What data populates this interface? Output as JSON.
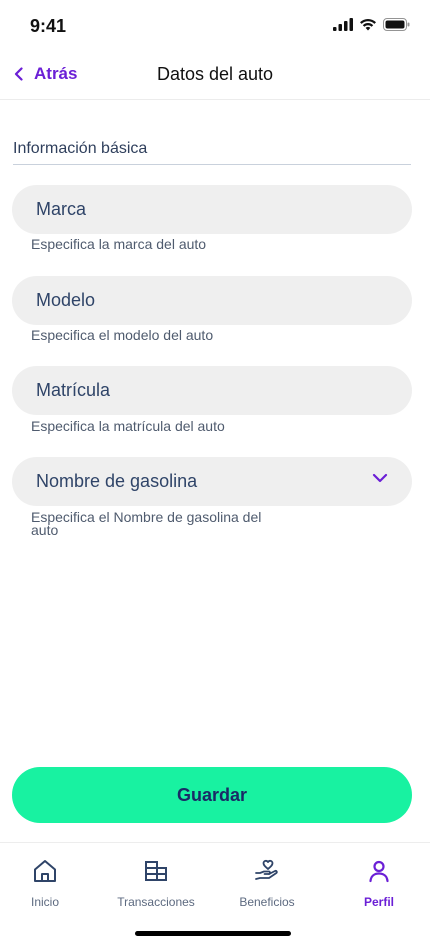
{
  "status_bar": {
    "time": "9:41"
  },
  "header": {
    "back_label": "Atrás",
    "title": "Datos del auto"
  },
  "form": {
    "section_title": "Información básica",
    "fields": [
      {
        "placeholder": "Marca",
        "hint": "Especifica la marca del auto"
      },
      {
        "placeholder": "Modelo",
        "hint": "Especifica el modelo del auto"
      },
      {
        "placeholder": "Matrícula",
        "hint": "Especifica la matrícula del auto"
      },
      {
        "placeholder": "Nombre de gasolina",
        "hint_line1": "Especifica el Nombre de gasolina del",
        "hint_line2": "auto"
      }
    ]
  },
  "save_button": {
    "label": "Guardar"
  },
  "tab_bar": {
    "items": [
      {
        "label": "Inicio",
        "icon": "home-icon",
        "active": false
      },
      {
        "label": "Transacciones",
        "icon": "transactions-icon",
        "active": false
      },
      {
        "label": "Beneficios",
        "icon": "benefits-icon",
        "active": false
      },
      {
        "label": "Perfil",
        "icon": "profile-icon",
        "active": true
      }
    ]
  },
  "colors": {
    "accent": "#6b1fd6",
    "primary_button": "#18f2a1",
    "field_bg": "#efefef",
    "text": "#2f4468"
  }
}
